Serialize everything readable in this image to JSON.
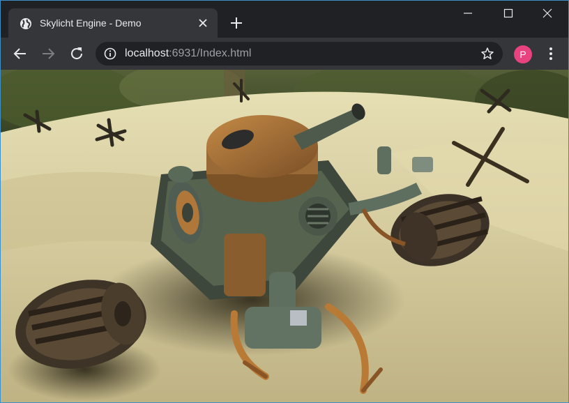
{
  "browser": {
    "tab": {
      "title": "Skylicht Engine - Demo",
      "favicon": "globe-icon",
      "close_icon": "close-icon"
    },
    "new_tab_icon": "plus-icon",
    "window_controls": [
      "minimize-icon",
      "maximize-icon",
      "close-icon"
    ],
    "toolbar": {
      "back_icon": "arrow-left-icon",
      "forward_icon": "arrow-right-icon",
      "reload_icon": "reload-icon",
      "site_info_icon": "info-icon",
      "url_host": "localhost",
      "url_rest": ":6931/Index.html",
      "bookmark_icon": "star-icon",
      "profile_initial": "P",
      "menu_icon": "kebab-menu-icon"
    }
  },
  "scene": {
    "description_icon": "3d-rendered-scene",
    "colors": {
      "sand": "#d8cfa4",
      "foliage": "#3f4a2a",
      "rust": "#b0773a",
      "metal": "#5c6b5e"
    }
  }
}
